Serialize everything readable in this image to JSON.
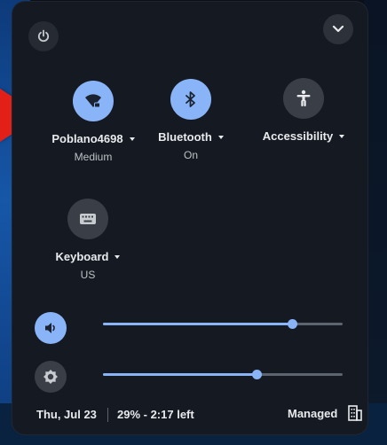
{
  "colors": {
    "panel_background": "#151a22",
    "active_toggle": "#8ab4f8",
    "inactive_toggle": "#3a3f47",
    "text_primary": "#e8eaed",
    "text_secondary": "#bdc1c6",
    "annotation_arrow": "#e32018"
  },
  "header": {
    "power_icon": "power-icon",
    "collapse_icon": "chevron-down-icon"
  },
  "features": {
    "network": {
      "icon": "wifi-icon",
      "label": "Poblano4698",
      "sublabel": "Medium",
      "active": true
    },
    "bluetooth": {
      "icon": "bluetooth-icon",
      "label": "Bluetooth",
      "sublabel": "On",
      "active": true
    },
    "accessibility": {
      "icon": "accessibility-icon",
      "label": "Accessibility",
      "active": false
    },
    "keyboard": {
      "icon": "keyboard-icon",
      "label": "Keyboard",
      "sublabel": "US",
      "active": false
    }
  },
  "sliders": {
    "volume": {
      "icon": "volume-icon",
      "level": 0.79
    },
    "brightness": {
      "icon": "brightness-icon",
      "level": 0.64
    }
  },
  "footer": {
    "date": "Thu, Jul 23",
    "battery": "29% - 2:17 left",
    "managed": "Managed",
    "managed_icon": "building-icon"
  }
}
